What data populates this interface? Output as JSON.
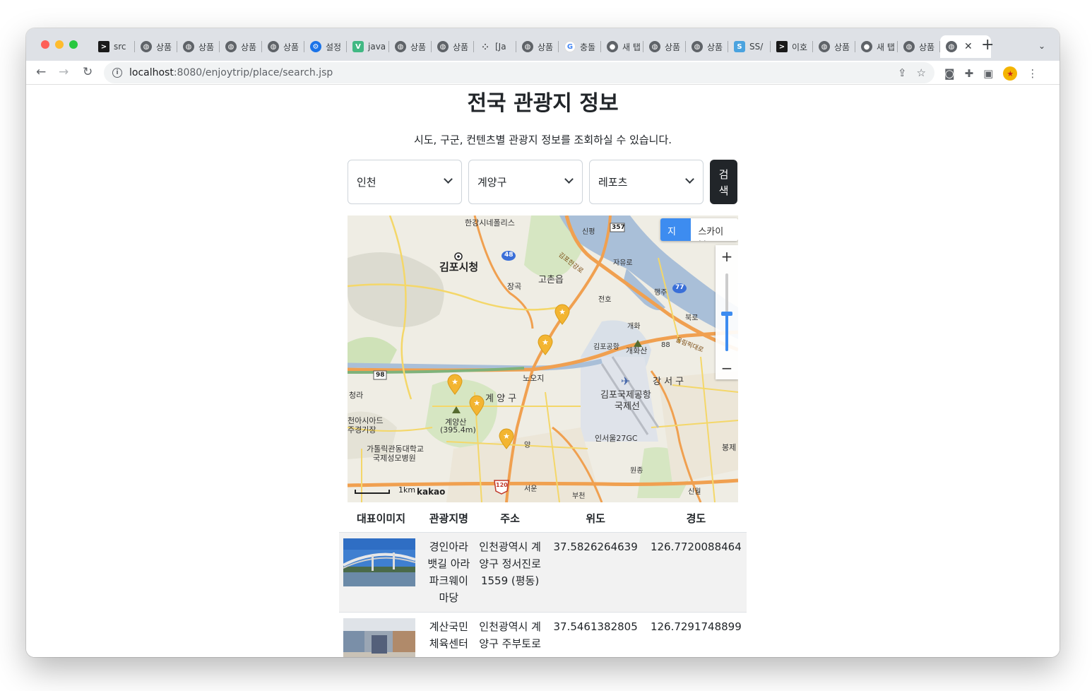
{
  "browser": {
    "tabs": [
      {
        "label": "src",
        "icon": "terminal-icon"
      },
      {
        "label": "상품",
        "icon": "globe-icon"
      },
      {
        "label": "상품",
        "icon": "globe-icon"
      },
      {
        "label": "상품",
        "icon": "globe-icon"
      },
      {
        "label": "상품",
        "icon": "globe-icon"
      },
      {
        "label": "설정",
        "icon": "gear-icon"
      },
      {
        "label": "java",
        "icon": "vue-icon"
      },
      {
        "label": "상품",
        "icon": "globe-icon"
      },
      {
        "label": "상품",
        "icon": "globe-icon"
      },
      {
        "label": "[Ja",
        "icon": "dots-icon"
      },
      {
        "label": "상품",
        "icon": "globe-icon"
      },
      {
        "label": "충돌",
        "icon": "google-icon"
      },
      {
        "label": "새 탭",
        "icon": "github-icon"
      },
      {
        "label": "상품",
        "icon": "globe-icon"
      },
      {
        "label": "상품",
        "icon": "globe-icon"
      },
      {
        "label": "SS/",
        "icon": "ss-icon"
      },
      {
        "label": "이호",
        "icon": "terminal-icon"
      },
      {
        "label": "상품",
        "icon": "globe-icon"
      },
      {
        "label": "새 탭",
        "icon": "github-icon"
      },
      {
        "label": "상품",
        "icon": "globe-icon"
      }
    ],
    "active_tab_close": "✕",
    "new_tab": "+",
    "tab_menu": "⌄",
    "url_host": "localhost",
    "url_path": ":8080/enjoytrip/place/search.jsp"
  },
  "page": {
    "title": "전국 관광지 정보",
    "subtitle": "시도, 구군, 컨텐츠별 관광지 정보를 조회하실 수 있습니다.",
    "filters": {
      "sido": "인천",
      "gugun": "계양구",
      "content_type": "레포츠",
      "search_label": "검색"
    }
  },
  "map": {
    "type_map": "지도",
    "type_skyview": "스카이뷰",
    "zoom_in": "+",
    "zoom_out": "−",
    "scale_label": "1km",
    "provider": "kakao",
    "labels": {
      "gimpo_cityhall": "김포시청",
      "gochon": "고촌읍",
      "gyeyang_gu": "계 양 구",
      "gangseo_gu": "강 서 구",
      "gimpo_airport": "김포국제공항",
      "gukjeseon": "국제선",
      "gyeyangsan": "계양산",
      "gyeyangsan_height": "(395.4m)",
      "hangang_nelis": "한강시네폴리스",
      "noeji": "노오지",
      "inseoul27": "인서울27GC",
      "janggok": "장곡",
      "gaehwasan": "개화산",
      "cheongna": "청라",
      "asiad": "천아시아드",
      "asiad2": "주경기장",
      "catholic": "가톨릭관동대학교",
      "catholic2": "국제성모병원",
      "bongje": "봉제",
      "gimpo_airport_ic": "김포공항",
      "seoun": "서운",
      "bucheon": "부천",
      "sinwol": "신월",
      "wonjong": "원종",
      "jayuro": "자유로",
      "haengju": "행주",
      "singok": "신평",
      "jeonho": "전호",
      "gaehwa": "개화",
      "bukro": "북로",
      "yang": "양",
      "olympic": "올림픽대로",
      "gimpo_hangang": "김포한강로",
      "route_48": "48",
      "route_357": "357",
      "route_77": "77",
      "route_98": "98",
      "route_120": "120",
      "route_88": "88"
    },
    "marker_count": 5
  },
  "table": {
    "headers": [
      "대표이미지",
      "관광지명",
      "주소",
      "위도",
      "경도"
    ],
    "rows": [
      {
        "name": "경인아라뱃길 아라파크웨이마당",
        "address": "인천광역시 계양구 정서진로 1559 (평동)",
        "lat": "37.5826264639",
        "lng": "126.7720088464",
        "image": "bridge-photo"
      },
      {
        "name": "계산국민체육센터",
        "address": "인천광역시 계양구 주부토로",
        "lat": "37.5461382805",
        "lng": "126.7291748899",
        "image": "gym-photo"
      }
    ]
  }
}
